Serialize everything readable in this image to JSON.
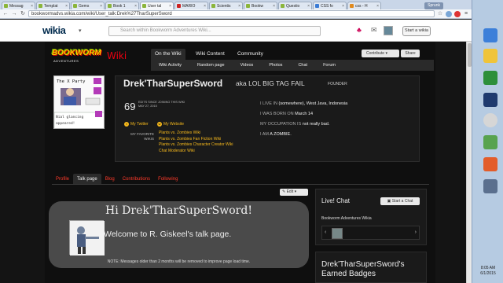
{
  "browser": {
    "tabs": [
      {
        "label": "Messag",
        "active": false
      },
      {
        "label": "Templat",
        "active": false
      },
      {
        "label": "Gems",
        "active": false
      },
      {
        "label": "Book 1",
        "active": false
      },
      {
        "label": "User tal",
        "active": true
      },
      {
        "label": "MARIO",
        "active": false
      },
      {
        "label": "Scientis",
        "active": false
      },
      {
        "label": "Bookw",
        "active": false
      },
      {
        "label": "Questio",
        "active": false
      },
      {
        "label": "CSS fo",
        "active": false
      },
      {
        "label": "css - H",
        "active": false
      }
    ],
    "window_user": "Sprunk",
    "url": "bookwormadvs.wikia.com/wiki/User_talk:Drek%27TharSuperSword"
  },
  "wikia_bar": {
    "logo": "wikia",
    "search_placeholder": "Search within Bookworm Adventures Wiki...",
    "start_wiki": "Start a wikia"
  },
  "wiki": {
    "wordmark_top": "BOOKWORM",
    "wordmark_sub": "ADVENTURES",
    "wordmark_wiki": "Wiki",
    "nav_tabs": [
      "On the Wiki",
      "Wiki Content",
      "Community"
    ],
    "nav_sub": [
      "Wiki Activity",
      "Random page",
      "Videos",
      "Photos",
      "Chat",
      "Forum"
    ],
    "contribute": "Contribute",
    "share": "Share"
  },
  "profile": {
    "username": "Drek'TharSuperSword",
    "aka": "aka LOL BIG TAG FAIL",
    "badge": "FOUNDER",
    "edit_count": "69",
    "edits_since": "EDITS SINCE JOINING THIS WIKI",
    "join_date": "MAY 27, 2015",
    "twitter": "My Twitter",
    "website": "My Website",
    "fav_label": "MY FAVORITE WIKIS",
    "fav_wikis": [
      "Plants vs. Zombies Wiki",
      "Plants vs. Zombies Fan Fiction Wiki",
      "Plants vs. Zombies Character Creator Wiki",
      "Chat Moderator Wiki"
    ],
    "live_label": "I LIVE IN",
    "live_value": "(somewhere), West Java, Indonesia",
    "born_label": "I WAS BORN ON",
    "born_value": "March 14",
    "occupation_label": "MY OCCUPATION IS",
    "occupation_value": "not really bad.",
    "iam_label": "I AM",
    "iam_value": "A ZOMBIE.",
    "avatar_caption": "The X Party",
    "avatar_line2": "Nial glancing",
    "avatar_line3": "appeared!"
  },
  "profile_tabs": [
    {
      "label": "Profile",
      "active": false
    },
    {
      "label": "Talk page",
      "active": true
    },
    {
      "label": "Blog",
      "active": false
    },
    {
      "label": "Contributions",
      "active": false
    },
    {
      "label": "Following",
      "active": false
    }
  ],
  "edit_button": "Edit",
  "talk": {
    "title": "Hi Drek'TharSuperSword!",
    "welcome": "Welcome to R. Giskeel's talk page.",
    "note": "NOTE: Messages older than 2 months will be removed to improve page load time."
  },
  "rail": {
    "live_chat_title": "Live! Chat",
    "start_chat": "Start a Chat",
    "chat_wiki": "Bookworm Adventures Wikia",
    "badges_title": "Drek'TharSuperSword's Earned Badges"
  },
  "taskbar": {
    "time": "8:05 AM",
    "date": "6/1/2015"
  },
  "colors": {
    "link_orange": "#f6b91c",
    "tab_red": "#ff3a2a",
    "background": "#141414"
  }
}
